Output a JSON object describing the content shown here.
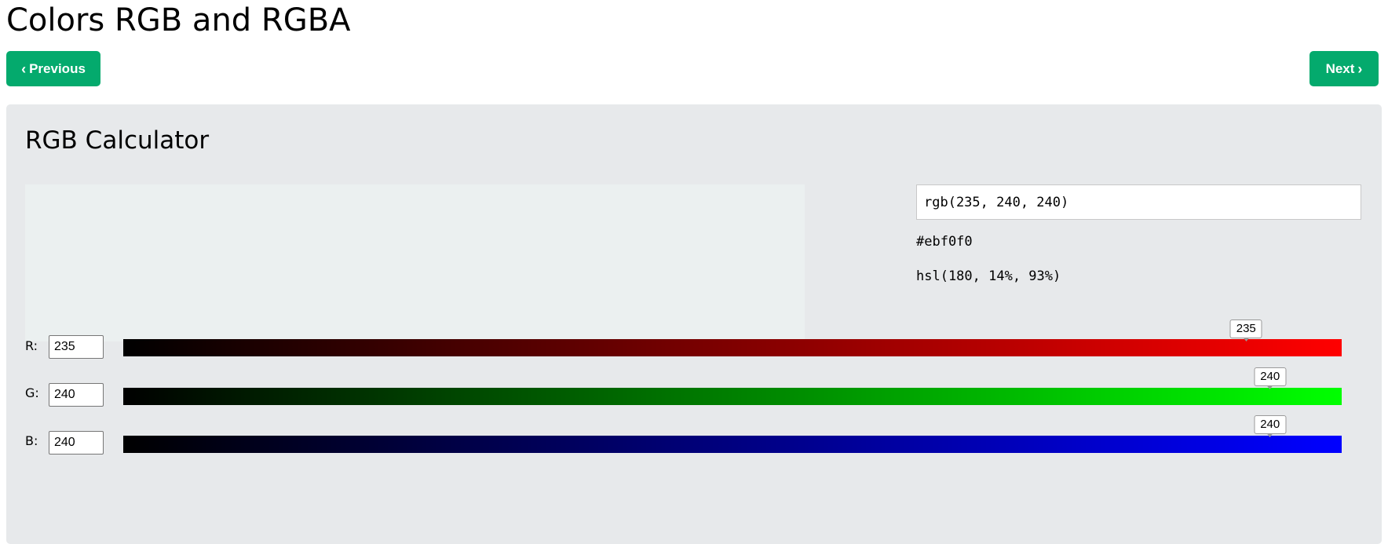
{
  "page": {
    "title": "Colors RGB and RGBA"
  },
  "nav": {
    "previous_label": "Previous",
    "next_label": "Next"
  },
  "calculator": {
    "title": "RGB Calculator",
    "preview_color": "#ebf0f0",
    "rgb_value": "rgb(235, 240, 240)",
    "hex_value": "#ebf0f0",
    "hsl_value": "hsl(180, 14%, 93%)"
  },
  "channels": [
    {
      "label": "R:",
      "value": "235",
      "tooltip": "235",
      "max": 255,
      "color": "#ff0000"
    },
    {
      "label": "G:",
      "value": "240",
      "tooltip": "240",
      "max": 255,
      "color": "#00ff00"
    },
    {
      "label": "B:",
      "value": "240",
      "tooltip": "240",
      "max": 255,
      "color": "#0000ff"
    }
  ],
  "colors": {
    "accent": "#04aa6d",
    "panel_bg": "#e7e9eb"
  }
}
